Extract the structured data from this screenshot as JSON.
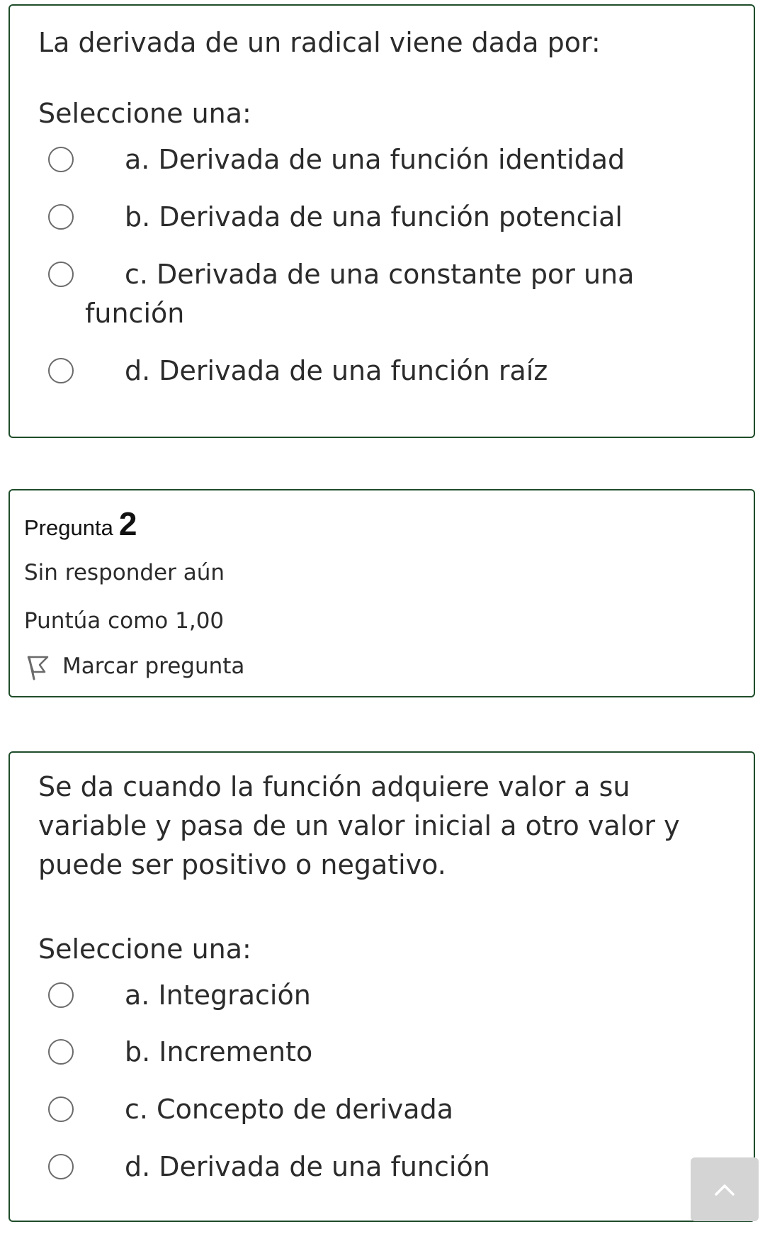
{
  "question1": {
    "text": "La derivada de un radical viene dada por:",
    "prompt": "Seleccione una:",
    "options": [
      {
        "label": "a. Derivada de una función identidad",
        "selected": false
      },
      {
        "label": "b. Derivada de una función potencial",
        "selected": false
      },
      {
        "label": "c. Derivada de una constante por una función",
        "selected": false
      },
      {
        "label": "d. Derivada de una función raíz",
        "selected": false
      }
    ]
  },
  "question2": {
    "info": {
      "title_word": "Pregunta",
      "number": "2",
      "status": "Sin responder aún",
      "score": "Puntúa como 1,00",
      "flag_label": "Marcar pregunta"
    },
    "text": "Se da cuando la función adquiere valor a su variable y pasa de un valor inicial a otro valor y puede ser positivo o negativo.",
    "prompt": "Seleccione una:",
    "options": [
      {
        "label": "a. Integración",
        "selected": false
      },
      {
        "label": "b. Incremento",
        "selected": false
      },
      {
        "label": "c. Concepto de derivada",
        "selected": false
      },
      {
        "label": "d. Derivada de una función",
        "selected": false
      }
    ]
  },
  "icons": {
    "flag": "flag-icon",
    "back_to_top": "chevron-up-icon"
  },
  "colors": {
    "card_border": "#1f4d2a",
    "text": "#2b2b2b",
    "radio_border": "#6b6b6b",
    "back_to_top_bg": "#d4d4d4"
  }
}
